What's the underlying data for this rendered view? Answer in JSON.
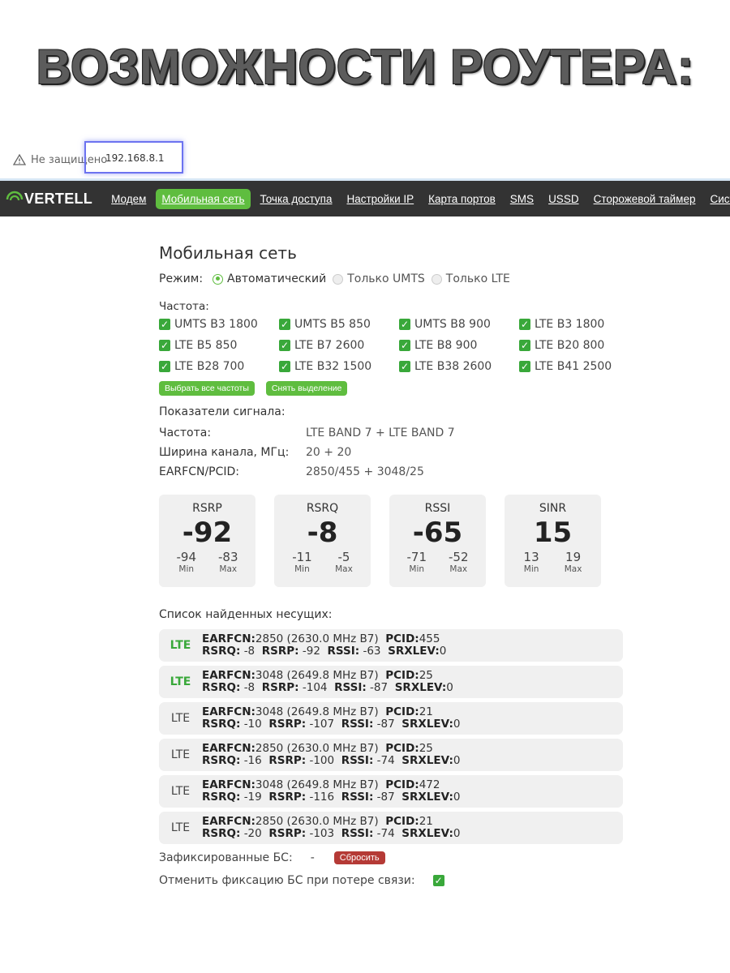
{
  "headline": "ВОЗМОЖНОСТИ РОУТЕРА:",
  "address_bar": {
    "security_text": "Не защищено",
    "url": "192.168.8.1",
    "icon": "warning-triangle-icon"
  },
  "navbar": {
    "logo_text": "VERTELL",
    "items": [
      {
        "label": "Модем"
      },
      {
        "label": "Мобильная сеть",
        "active": true
      },
      {
        "label": "Точка доступа"
      },
      {
        "label": "Настройки IP"
      },
      {
        "label": "Карта портов"
      },
      {
        "label": "SMS"
      },
      {
        "label": "USSD"
      },
      {
        "label": "Сторожевой таймер"
      },
      {
        "label": "Система"
      }
    ],
    "accent_color": "#5fbd3f"
  },
  "main": {
    "title": "Мобильная сеть",
    "mode": {
      "label": "Режим:",
      "options": [
        {
          "label": "Автоматический",
          "selected": true
        },
        {
          "label": "Только UMTS",
          "selected": false
        },
        {
          "label": "Только LTE",
          "selected": false
        }
      ]
    },
    "frequency": {
      "label": "Частота:",
      "bands": [
        "UMTS B3 1800",
        "UMTS B5 850",
        "UMTS B8 900",
        "LTE B3 1800",
        "LTE B5 850",
        "LTE B7 2600",
        "LTE B8 900",
        "LTE B20 800",
        "LTE B28 700",
        "LTE B32 1500",
        "LTE B38 2600",
        "LTE B41 2500"
      ],
      "select_all_label": "Выбрать все частоты",
      "clear_label": "Снять выделение"
    },
    "signal": {
      "title": "Показатели сигнала:",
      "rows": [
        {
          "key": "Частота:",
          "value": "LTE BAND 7 + LTE BAND 7"
        },
        {
          "key": "Ширина канала, МГц:",
          "value": "20 + 20"
        },
        {
          "key": "EARFCN/PCID:",
          "value": "2850/455 + 3048/25"
        }
      ],
      "cards": [
        {
          "name": "RSRP",
          "value": "-92",
          "min": "-94",
          "max": "-83"
        },
        {
          "name": "RSRQ",
          "value": "-8",
          "min": "-11",
          "max": "-5"
        },
        {
          "name": "RSSI",
          "value": "-65",
          "min": "-71",
          "max": "-52"
        },
        {
          "name": "SINR",
          "value": "15",
          "min": "13",
          "max": "19"
        }
      ],
      "min_label": "Min",
      "max_label": "Max"
    },
    "carriers": {
      "title": "Список найденных несущих:",
      "items": [
        {
          "tech": "LTE",
          "active": true,
          "earfcn": "2850 (2630.0 MHz B7)",
          "pcid": "455",
          "rsrq": "-8",
          "rsrp": "-92",
          "rssi": "-63",
          "srxlev": "0"
        },
        {
          "tech": "LTE",
          "active": true,
          "earfcn": "3048 (2649.8 MHz B7)",
          "pcid": "25",
          "rsrq": "-8",
          "rsrp": "-104",
          "rssi": "-87",
          "srxlev": "0"
        },
        {
          "tech": "LTE",
          "active": false,
          "earfcn": "3048 (2649.8 MHz B7)",
          "pcid": "21",
          "rsrq": "-10",
          "rsrp": "-107",
          "rssi": "-87",
          "srxlev": "0"
        },
        {
          "tech": "LTE",
          "active": false,
          "earfcn": "2850 (2630.0 MHz B7)",
          "pcid": "25",
          "rsrq": "-16",
          "rsrp": "-100",
          "rssi": "-74",
          "srxlev": "0"
        },
        {
          "tech": "LTE",
          "active": false,
          "earfcn": "3048 (2649.8 MHz B7)",
          "pcid": "472",
          "rsrq": "-19",
          "rsrp": "-116",
          "rssi": "-87",
          "srxlev": "0"
        },
        {
          "tech": "LTE",
          "active": false,
          "earfcn": "2850 (2630.0 MHz B7)",
          "pcid": "21",
          "rsrq": "-20",
          "rsrp": "-103",
          "rssi": "-74",
          "srxlev": "0"
        }
      ],
      "labels": {
        "earfcn": "EARFCN:",
        "pcid": "PCID:",
        "rsrq": "RSRQ:",
        "rsrp": "RSRP:",
        "rssi": "RSSI:",
        "srxlev": "SRXLEV:"
      }
    },
    "fixed_bs": {
      "label": "Зафиксированные БС:",
      "value": "-",
      "reset_label": "Сбросить"
    },
    "cancel_fix": {
      "label": "Отменить фиксацию БС при потере связи:",
      "checked": true
    }
  }
}
